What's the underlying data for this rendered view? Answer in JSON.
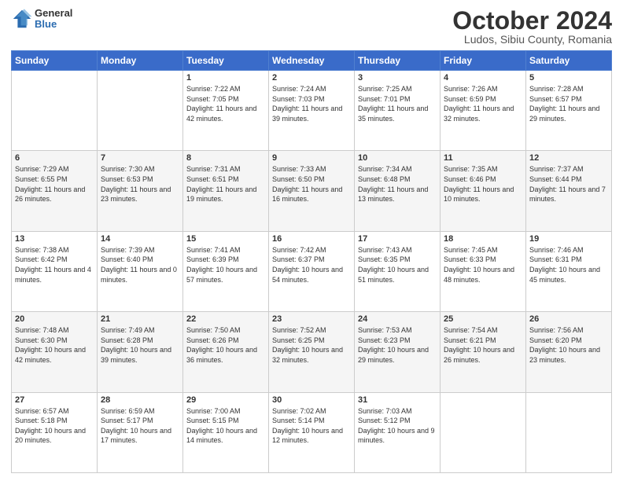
{
  "header": {
    "logo": {
      "general": "General",
      "blue": "Blue"
    },
    "title": "October 2024",
    "location": "Ludos, Sibiu County, Romania"
  },
  "days_of_week": [
    "Sunday",
    "Monday",
    "Tuesday",
    "Wednesday",
    "Thursday",
    "Friday",
    "Saturday"
  ],
  "weeks": [
    [
      {
        "day": "",
        "info": ""
      },
      {
        "day": "",
        "info": ""
      },
      {
        "day": "1",
        "info": "Sunrise: 7:22 AM\nSunset: 7:05 PM\nDaylight: 11 hours and 42 minutes."
      },
      {
        "day": "2",
        "info": "Sunrise: 7:24 AM\nSunset: 7:03 PM\nDaylight: 11 hours and 39 minutes."
      },
      {
        "day": "3",
        "info": "Sunrise: 7:25 AM\nSunset: 7:01 PM\nDaylight: 11 hours and 35 minutes."
      },
      {
        "day": "4",
        "info": "Sunrise: 7:26 AM\nSunset: 6:59 PM\nDaylight: 11 hours and 32 minutes."
      },
      {
        "day": "5",
        "info": "Sunrise: 7:28 AM\nSunset: 6:57 PM\nDaylight: 11 hours and 29 minutes."
      }
    ],
    [
      {
        "day": "6",
        "info": "Sunrise: 7:29 AM\nSunset: 6:55 PM\nDaylight: 11 hours and 26 minutes."
      },
      {
        "day": "7",
        "info": "Sunrise: 7:30 AM\nSunset: 6:53 PM\nDaylight: 11 hours and 23 minutes."
      },
      {
        "day": "8",
        "info": "Sunrise: 7:31 AM\nSunset: 6:51 PM\nDaylight: 11 hours and 19 minutes."
      },
      {
        "day": "9",
        "info": "Sunrise: 7:33 AM\nSunset: 6:50 PM\nDaylight: 11 hours and 16 minutes."
      },
      {
        "day": "10",
        "info": "Sunrise: 7:34 AM\nSunset: 6:48 PM\nDaylight: 11 hours and 13 minutes."
      },
      {
        "day": "11",
        "info": "Sunrise: 7:35 AM\nSunset: 6:46 PM\nDaylight: 11 hours and 10 minutes."
      },
      {
        "day": "12",
        "info": "Sunrise: 7:37 AM\nSunset: 6:44 PM\nDaylight: 11 hours and 7 minutes."
      }
    ],
    [
      {
        "day": "13",
        "info": "Sunrise: 7:38 AM\nSunset: 6:42 PM\nDaylight: 11 hours and 4 minutes."
      },
      {
        "day": "14",
        "info": "Sunrise: 7:39 AM\nSunset: 6:40 PM\nDaylight: 11 hours and 0 minutes."
      },
      {
        "day": "15",
        "info": "Sunrise: 7:41 AM\nSunset: 6:39 PM\nDaylight: 10 hours and 57 minutes."
      },
      {
        "day": "16",
        "info": "Sunrise: 7:42 AM\nSunset: 6:37 PM\nDaylight: 10 hours and 54 minutes."
      },
      {
        "day": "17",
        "info": "Sunrise: 7:43 AM\nSunset: 6:35 PM\nDaylight: 10 hours and 51 minutes."
      },
      {
        "day": "18",
        "info": "Sunrise: 7:45 AM\nSunset: 6:33 PM\nDaylight: 10 hours and 48 minutes."
      },
      {
        "day": "19",
        "info": "Sunrise: 7:46 AM\nSunset: 6:31 PM\nDaylight: 10 hours and 45 minutes."
      }
    ],
    [
      {
        "day": "20",
        "info": "Sunrise: 7:48 AM\nSunset: 6:30 PM\nDaylight: 10 hours and 42 minutes."
      },
      {
        "day": "21",
        "info": "Sunrise: 7:49 AM\nSunset: 6:28 PM\nDaylight: 10 hours and 39 minutes."
      },
      {
        "day": "22",
        "info": "Sunrise: 7:50 AM\nSunset: 6:26 PM\nDaylight: 10 hours and 36 minutes."
      },
      {
        "day": "23",
        "info": "Sunrise: 7:52 AM\nSunset: 6:25 PM\nDaylight: 10 hours and 32 minutes."
      },
      {
        "day": "24",
        "info": "Sunrise: 7:53 AM\nSunset: 6:23 PM\nDaylight: 10 hours and 29 minutes."
      },
      {
        "day": "25",
        "info": "Sunrise: 7:54 AM\nSunset: 6:21 PM\nDaylight: 10 hours and 26 minutes."
      },
      {
        "day": "26",
        "info": "Sunrise: 7:56 AM\nSunset: 6:20 PM\nDaylight: 10 hours and 23 minutes."
      }
    ],
    [
      {
        "day": "27",
        "info": "Sunrise: 6:57 AM\nSunset: 5:18 PM\nDaylight: 10 hours and 20 minutes."
      },
      {
        "day": "28",
        "info": "Sunrise: 6:59 AM\nSunset: 5:17 PM\nDaylight: 10 hours and 17 minutes."
      },
      {
        "day": "29",
        "info": "Sunrise: 7:00 AM\nSunset: 5:15 PM\nDaylight: 10 hours and 14 minutes."
      },
      {
        "day": "30",
        "info": "Sunrise: 7:02 AM\nSunset: 5:14 PM\nDaylight: 10 hours and 12 minutes."
      },
      {
        "day": "31",
        "info": "Sunrise: 7:03 AM\nSunset: 5:12 PM\nDaylight: 10 hours and 9 minutes."
      },
      {
        "day": "",
        "info": ""
      },
      {
        "day": "",
        "info": ""
      }
    ]
  ]
}
